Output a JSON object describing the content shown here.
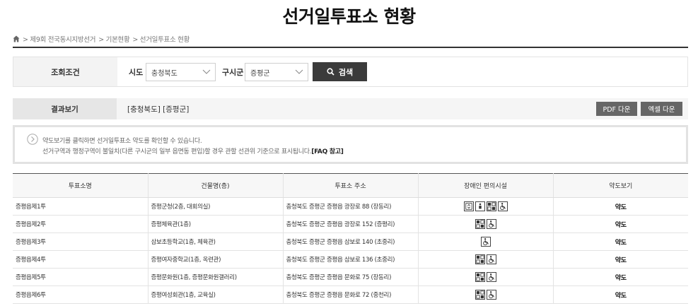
{
  "page": {
    "title": "선거일투표소 현황"
  },
  "breadcrumb": {
    "items": [
      "> 제9회 전국동시지방선거",
      "> 기본현황",
      "> 선거일투표소 현황"
    ]
  },
  "search": {
    "label": "조회조건",
    "sido_label": "시도",
    "sido_value": "충청북도",
    "sigungu_label": "구시군",
    "sigungu_value": "증평군",
    "button_label": "검색"
  },
  "result": {
    "label": "결과보기",
    "text": "[충청북도] [증평군]",
    "pdf_label": "PDF 다운",
    "excel_label": "엑셀 다운"
  },
  "notice": {
    "line1": "약도보기를 클릭하면 선거일투표소 약도를 확인할 수 있습니다.",
    "line2": "선거구역과 행정구역이 불일치(다른 구시군의 일부 읍면동 편입)할 경우 관할 선관위 기준으로 표시됩니다.",
    "faq": "[FAQ 참고]"
  },
  "table": {
    "headers": [
      "투표소명",
      "건물명(층)",
      "투표소 주소",
      "장애인 편의시설",
      "약도보기"
    ],
    "rows": [
      {
        "name": "증평읍제1투",
        "building": "증평군청(2층, 대회의실)",
        "address": "충청북도 증평군 증평읍 광장로 88 (장동리)",
        "facilities": [
          "elevator-icon",
          "stairs-lift-icon",
          "ramp-icon",
          "wheelchair-icon"
        ],
        "map": "약도"
      },
      {
        "name": "증평읍제2투",
        "building": "증평체육관(1층)",
        "address": "충청북도 증평군 증평읍 광장로 152 (증평리)",
        "facilities": [
          "ramp-icon",
          "wheelchair-icon"
        ],
        "map": "약도"
      },
      {
        "name": "증평읍제3투",
        "building": "삼보초등학교(1층, 체육관)",
        "address": "충청북도 증평군 증평읍 삼보로 140 (초중리)",
        "facilities": [
          "wheelchair-icon"
        ],
        "map": "약도"
      },
      {
        "name": "증평읍제4투",
        "building": "증평여자중학교(1층, 옥련관)",
        "address": "충청북도 증평군 증평읍 삼보로 136 (초중리)",
        "facilities": [
          "ramp-icon",
          "wheelchair-icon"
        ],
        "map": "약도"
      },
      {
        "name": "증평읍제5투",
        "building": "증평문화원(1층, 증평문화원갤러리)",
        "address": "충청북도 증평군 증평읍 문화로 75 (장동리)",
        "facilities": [
          "ramp-icon",
          "wheelchair-icon"
        ],
        "map": "약도"
      },
      {
        "name": "증평읍제6투",
        "building": "증평여성회관(1층, 교육실)",
        "address": "충청북도 증평군 증평읍 문화로 72 (중천리)",
        "facilities": [
          "ramp-icon",
          "wheelchair-icon"
        ],
        "map": "약도"
      }
    ]
  }
}
